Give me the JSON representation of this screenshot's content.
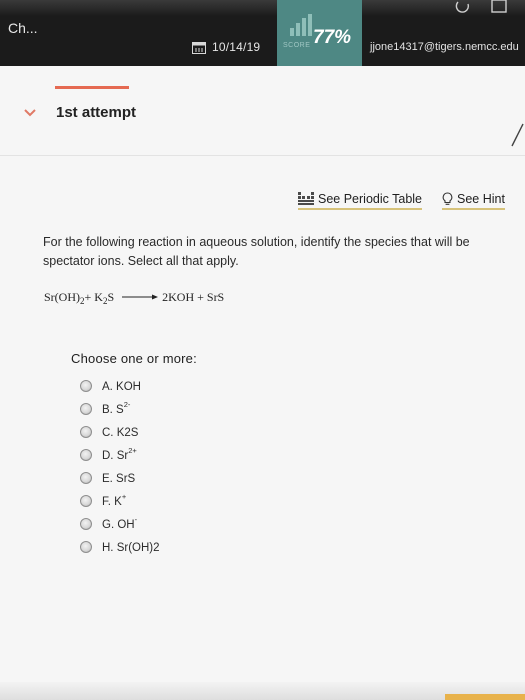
{
  "header": {
    "app_title": "Ch...",
    "date": "10/14/19",
    "score_percent": "77%",
    "score_label": "SCORE",
    "user_email": "jjone14317@tigers.nemcc.edu"
  },
  "attempt": {
    "title": "1st attempt"
  },
  "tools": {
    "periodic_table": "See Periodic Table",
    "hint": "See Hint"
  },
  "question": {
    "prompt": "For the following reaction in aqueous solution, identify the species that will be spectator ions. Select all that apply.",
    "equation": {
      "r1": "Sr(OH)",
      "r1_sub": "2",
      "plus1": " + K",
      "r2_sub": "2",
      "r2_tail": "S",
      "products": "2KOH + SrS"
    }
  },
  "choices": {
    "label": "Choose one or more:",
    "items": [
      {
        "text": "A. KOH",
        "sup": ""
      },
      {
        "text": "B. S",
        "sup": "2-"
      },
      {
        "text": "C. K2S",
        "sup": ""
      },
      {
        "text": "D. Sr",
        "sup": "2+"
      },
      {
        "text": "E. SrS",
        "sup": ""
      },
      {
        "text": "F. K",
        "sup": "+"
      },
      {
        "text": "G. OH",
        "sup": "-"
      },
      {
        "text": "H. Sr(OH)2",
        "sup": ""
      }
    ]
  },
  "colors": {
    "top_bar": "#1b1b1b",
    "score_box": "#4e8884",
    "accent_orange": "#e56a52",
    "tool_underline": "#d6c27a"
  }
}
